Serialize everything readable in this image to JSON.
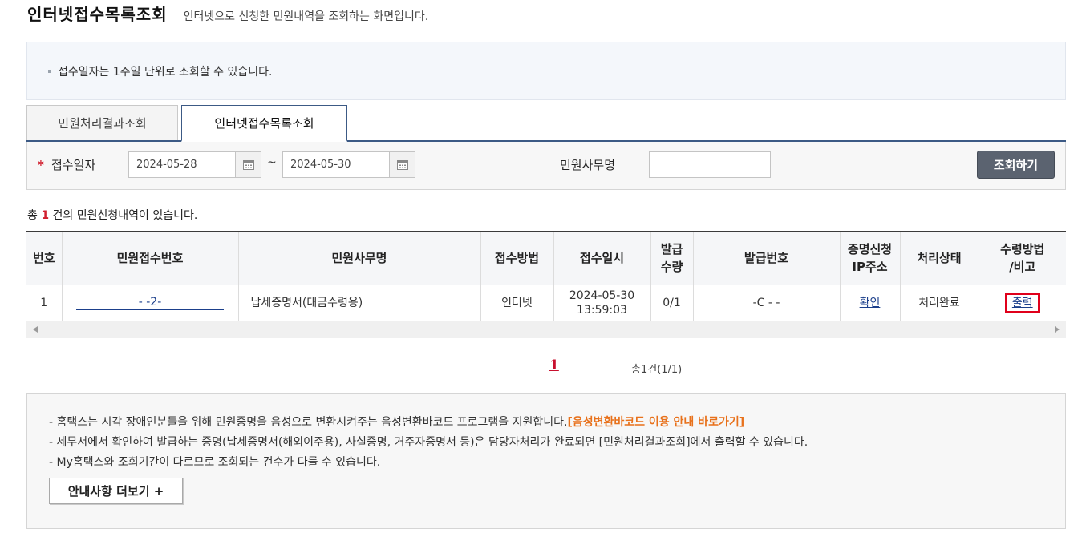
{
  "header": {
    "title": "인터넷접수목록조회",
    "description": "인터넷으로 신청한 민원내역을 조회하는 화면입니다."
  },
  "notice": {
    "text": "접수일자는 1주일 단위로 조회할 수 있습니다."
  },
  "tabs": [
    {
      "label": "민원처리결과조회",
      "active": false
    },
    {
      "label": "인터넷접수목록조회",
      "active": true
    }
  ],
  "search": {
    "date_label": "접수일자",
    "required_mark": "*",
    "date_from": "2024-05-28",
    "date_to": "2024-05-30",
    "range_separator": "~",
    "service_label": "민원사무명",
    "service_value": "",
    "search_button": "조회하기"
  },
  "summary": {
    "prefix": "총 ",
    "count": "1",
    "suffix": " 건의 민원신청내역이 있습니다."
  },
  "table": {
    "headers": {
      "no": "번호",
      "receipt_no": "민원접수번호",
      "service_name": "민원사무명",
      "method": "접수방법",
      "received_at": "접수일시",
      "qty_line1": "발급",
      "qty_line2": "수량",
      "issue_no": "발급번호",
      "ip_line1": "증명신청",
      "ip_line2": "IP주소",
      "status": "처리상태",
      "receive_line1": "수령방법",
      "receive_line2": "/비고"
    },
    "rows": [
      {
        "no": "1",
        "receipt_no": "-      -2-",
        "service_name": "납세증명서(대금수령용)",
        "method": "인터넷",
        "received_date": "2024-05-30",
        "received_time": "13:59:03",
        "qty": "0/1",
        "issue_no": "-C    -      -",
        "ip_link": "확인",
        "status": "처리완료",
        "receive_link": "출력"
      }
    ]
  },
  "pagination": {
    "current": "1",
    "total": "총1건(1/1)"
  },
  "guide": {
    "line1_text": "- 홈택스는 시각 장애인분들을 위해 민원증명을 음성으로 변환시켜주는 음성변환바코드 프로그램을 지원합니다.",
    "line1_link": "[음성변환바코드 이용 안내 바로가기]",
    "line2": "- 세무서에서 확인하여 발급하는 증명(납세증명서(해외이주용), 사실증명, 거주자증명서 등)은 담당자처리가 완료되면 [민원처리결과조회]에서 출력할 수 있습니다.",
    "line3": "- My홈택스와 조회기간이 다르므로 조회되는 건수가 다를 수 있습니다.",
    "more_button": "안내사항 더보기 +"
  },
  "colors": {
    "accent_red": "#d1202f",
    "tab_border": "#3c5a85",
    "link_blue": "#1b3f8b",
    "guide_link_orange": "#e8711b",
    "highlight_red": "#e0001b"
  },
  "icons": {
    "calendar": "calendar-icon",
    "scroll_left": "arrow-left-icon",
    "scroll_right": "arrow-right-icon"
  }
}
